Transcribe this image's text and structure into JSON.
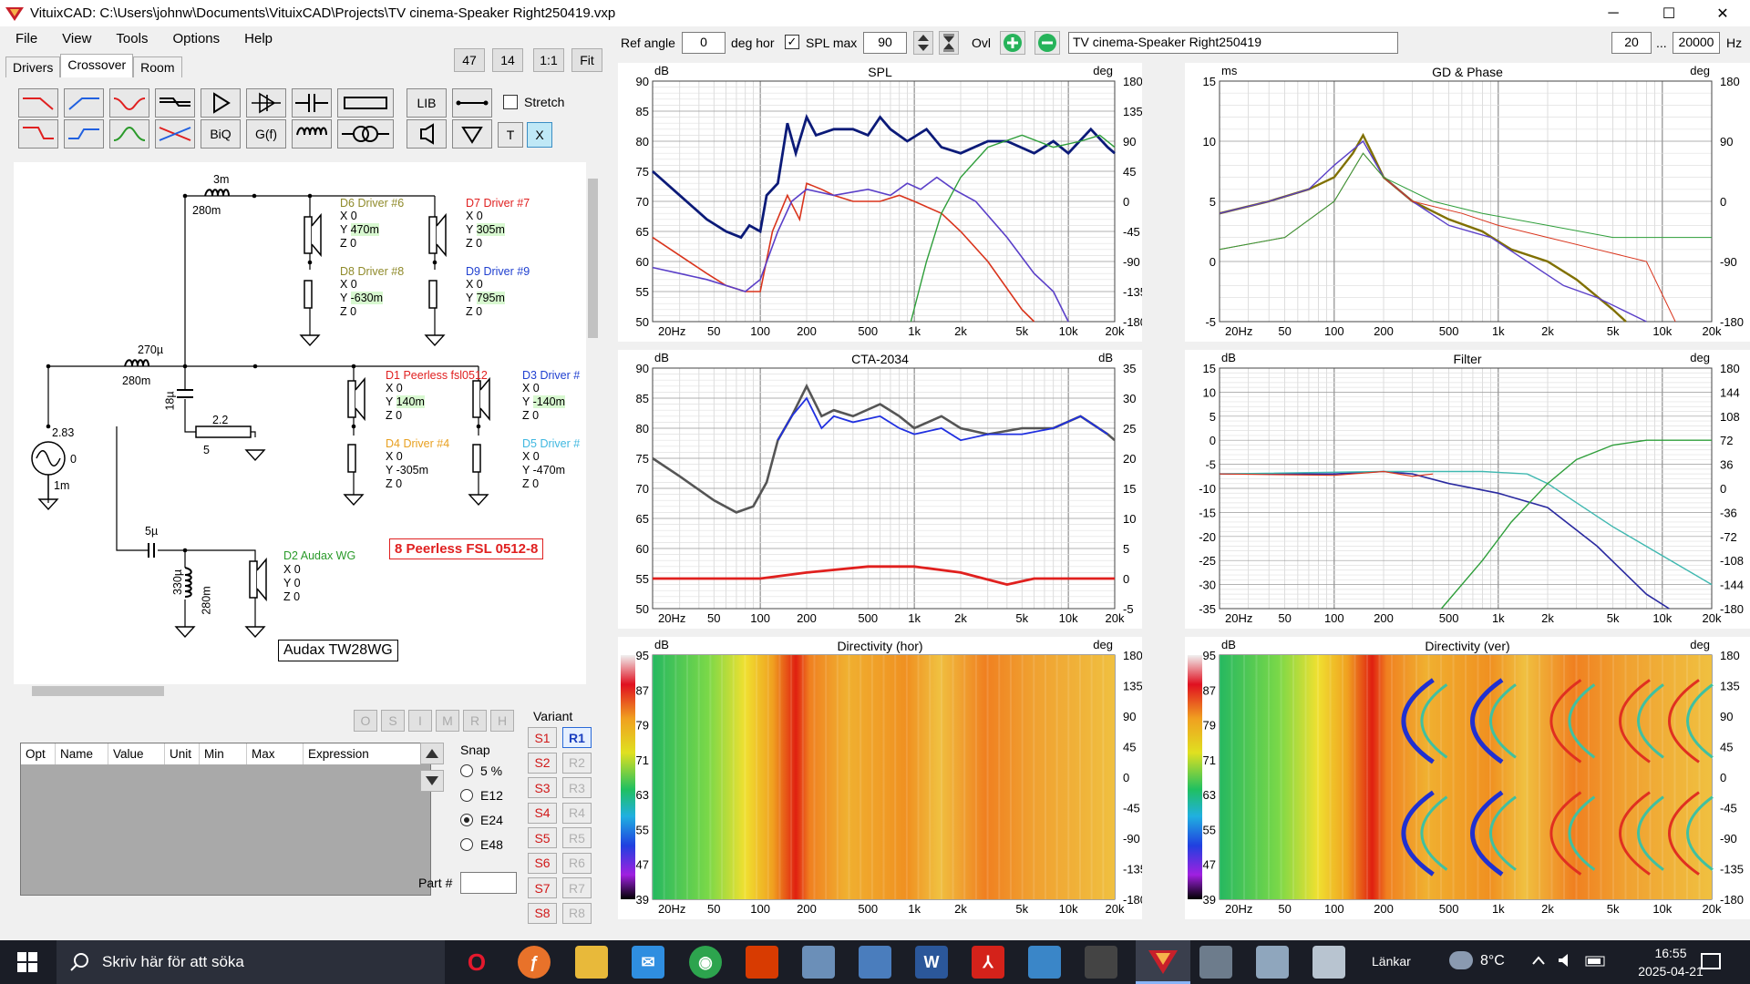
{
  "window": {
    "title": "VituixCAD: C:\\Users\\johnw\\Documents\\VituixCAD\\Projects\\TV cinema-Speaker Right250419.vxp",
    "minimize": "─",
    "maximize": "☐",
    "close": "✕"
  },
  "menu": [
    "File",
    "View",
    "Tools",
    "Options",
    "Help"
  ],
  "tabs": [
    "Drivers",
    "Crossover",
    "Room"
  ],
  "toolbar": {
    "b47": "47",
    "b14": "14",
    "b11": "1:1",
    "fit": "Fit",
    "lib": "LIB",
    "biq": "BiQ",
    "gf": "G(f)",
    "t": "T",
    "x": "X",
    "stretch": "Stretch"
  },
  "top": {
    "ref_angle_label": "Ref angle",
    "ref_angle": "0",
    "deg_hor": "deg hor",
    "spl_max_label": "SPL max",
    "spl_max": "90",
    "ovl": "Ovl",
    "project": "TV cinema-Speaker Right250419",
    "fmin": "20",
    "dots": "...",
    "fmax": "20000",
    "hz": "Hz"
  },
  "schematic": {
    "l1": "3m",
    "l1b": "280m",
    "l2": "270µ",
    "l2b": "280m",
    "c1": "18µ",
    "r1": "2.2",
    "r1b": "5",
    "src": "2.83",
    "src0": "0",
    "src1": "1m",
    "c2": "5µ",
    "l3": "330µ",
    "l3b": "280m",
    "d6": {
      "name": "D6 Driver #6",
      "x": "X 0",
      "y": "470m",
      "z": "Z 0"
    },
    "d7": {
      "name": "D7 Driver #7",
      "x": "X 0",
      "y": "305m",
      "z": "Z 0"
    },
    "d8": {
      "name": "D8 Driver #8",
      "x": "X 0",
      "y": "-630m",
      "z": "Z 0"
    },
    "d9": {
      "name": "D9 Driver #9",
      "x": "X 0",
      "y": "795m",
      "z": "Z 0"
    },
    "d1": {
      "name": "D1 Peerless fsl0512",
      "x": "X 0",
      "y": "140m",
      "z": "Z 0"
    },
    "d3": {
      "name": "D3 Driver #",
      "x": "X 0",
      "y": "-140m",
      "z": "Z 0"
    },
    "d4": {
      "name": "D4 Driver #4",
      "x": "X 0",
      "y": "Y -305m",
      "z": "Z 0"
    },
    "d5": {
      "name": "D5 Driver #",
      "x": "X 0",
      "y": "Y -470m",
      "z": "Z 0"
    },
    "d2": {
      "name": "D2 Audax WG",
      "x": "X 0",
      "y": "Y 0",
      "z": "Z 0"
    },
    "ylabel": "Y",
    "box1": "8 Peerless FSL 0512-8",
    "box2": "Audax TW28WG"
  },
  "opt_buttons": [
    "O",
    "S",
    "I",
    "M",
    "R",
    "H"
  ],
  "table_headers": [
    "Opt",
    "Name",
    "Value",
    "Unit",
    "Min",
    "Max",
    "Expression"
  ],
  "snap": {
    "label": "Snap",
    "options": [
      "5 %",
      "E12",
      "E24",
      "E48"
    ],
    "selected": "E24"
  },
  "part_label": "Part #",
  "variant": {
    "label": "Variant",
    "s": [
      "S1",
      "S2",
      "S3",
      "S4",
      "S5",
      "S6",
      "S7",
      "S8"
    ],
    "r": [
      "R1",
      "R2",
      "R3",
      "R4",
      "R5",
      "R6",
      "R7",
      "R8"
    ]
  },
  "charts": {
    "spl": {
      "title": "SPL",
      "yl": "dB",
      "yr": "deg",
      "left": [
        "90",
        "85",
        "80",
        "75",
        "70",
        "65",
        "60",
        "55",
        "50"
      ],
      "right": [
        "180",
        "135",
        "90",
        "45",
        "0",
        "-45",
        "-90",
        "-135",
        "-180"
      ]
    },
    "gd": {
      "title": "GD & Phase",
      "yl": "ms",
      "yr": "deg",
      "left": [
        "15",
        "10",
        "5",
        "0",
        "-5"
      ],
      "right": [
        "180",
        "90",
        "0",
        "-90",
        "-180"
      ]
    },
    "cta": {
      "title": "CTA-2034",
      "yl": "dB",
      "yr": "dB",
      "left": [
        "90",
        "85",
        "80",
        "75",
        "70",
        "65",
        "60",
        "55",
        "50"
      ],
      "right": [
        "35",
        "30",
        "25",
        "20",
        "15",
        "10",
        "5",
        "0",
        "-5"
      ]
    },
    "filter": {
      "title": "Filter",
      "yl": "dB",
      "yr": "deg",
      "left": [
        "15",
        "10",
        "5",
        "0",
        "-5",
        "-10",
        "-15",
        "-20",
        "-25",
        "-30",
        "-35"
      ],
      "right": [
        "180",
        "144",
        "108",
        "72",
        "36",
        "0",
        "-36",
        "-72",
        "-108",
        "-144",
        "-180"
      ]
    },
    "dirh": {
      "title": "Directivity (hor)",
      "yl": "dB",
      "yr": "deg",
      "left": [
        "95",
        "87",
        "79",
        "71",
        "63",
        "55",
        "47",
        "39"
      ],
      "right": [
        "180",
        "135",
        "90",
        "45",
        "0",
        "-45",
        "-90",
        "-135",
        "-180"
      ]
    },
    "dirv": {
      "title": "Directivity (ver)",
      "yl": "dB",
      "yr": "deg",
      "left": [
        "95",
        "87",
        "79",
        "71",
        "63",
        "55",
        "47",
        "39"
      ],
      "right": [
        "180",
        "135",
        "90",
        "45",
        "0",
        "-45",
        "-90",
        "-135",
        "-180"
      ]
    },
    "x": [
      "20Hz",
      "50",
      "100",
      "200",
      "500",
      "1k",
      "2k",
      "5k",
      "10k",
      "20k"
    ]
  },
  "colors": {
    "navy": "#0b1a78",
    "red": "#d9341c",
    "purple": "#5a3fc8",
    "green": "#2e9e3a",
    "olive": "#807000",
    "cyan": "#3fb8b0",
    "grey": "#555555",
    "spl_red": "#e0201e"
  },
  "taskbar": {
    "search": "Skriv här för att söka",
    "links": "Länkar",
    "temp": "8°C",
    "time": "16:55",
    "date": "2025-04-21"
  }
}
